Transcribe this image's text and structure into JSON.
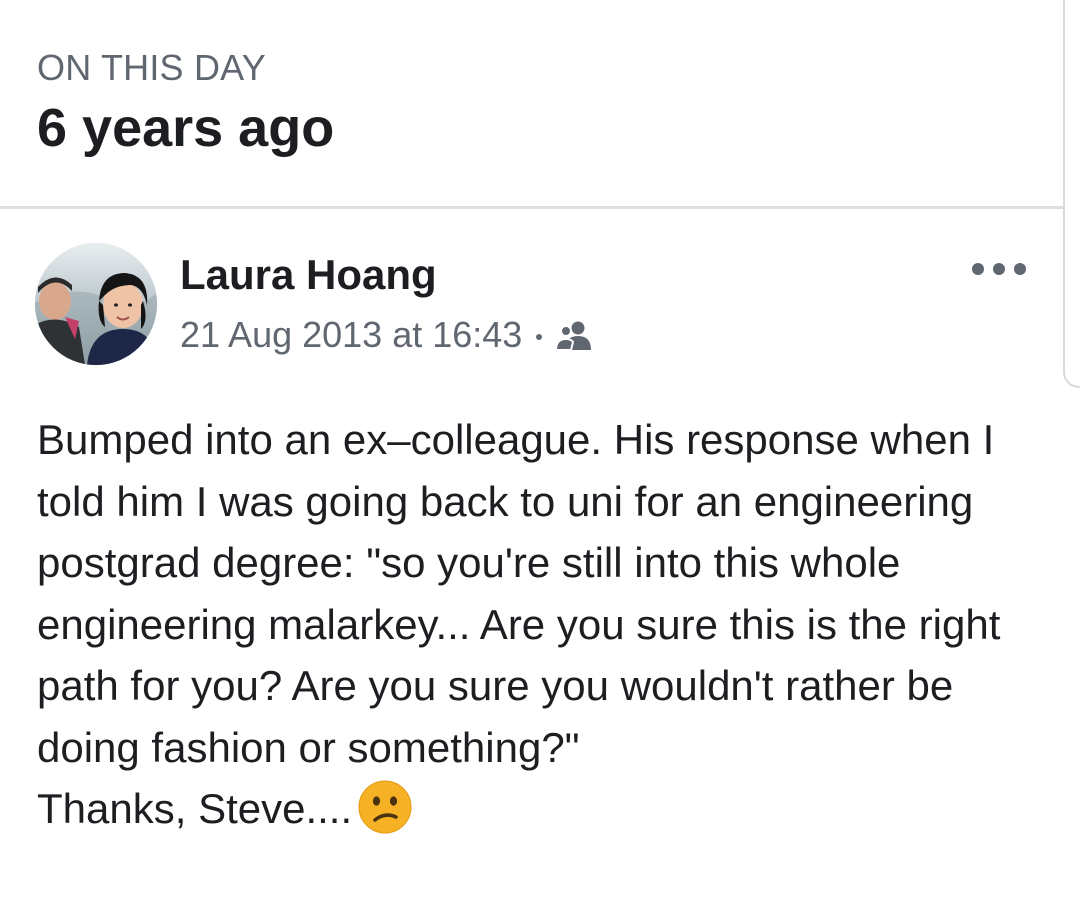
{
  "memory": {
    "kicker": "ON THIS DAY",
    "years_ago": "6 years ago"
  },
  "post": {
    "author": "Laura Hoang",
    "timestamp": "21 Aug 2013 at 16:43",
    "audience_icon": "friends-icon",
    "more_icon": "more-options-icon",
    "text": "Bumped into an ex–colleague. His response when I told him I was going back to uni for an engineering postgrad degree: \"so you're still into this whole engineering malarkey... Are you sure this is the right path for you? Are you sure you wouldn't rather be doing fashion or something?\"",
    "sign_off": "Thanks, Steve....",
    "emoji_icon": "confused-face-emoji"
  },
  "colors": {
    "primary_text": "#1c1e21",
    "secondary_text": "#606770",
    "divider": "#dddfe2",
    "emoji": "#f7b125"
  }
}
